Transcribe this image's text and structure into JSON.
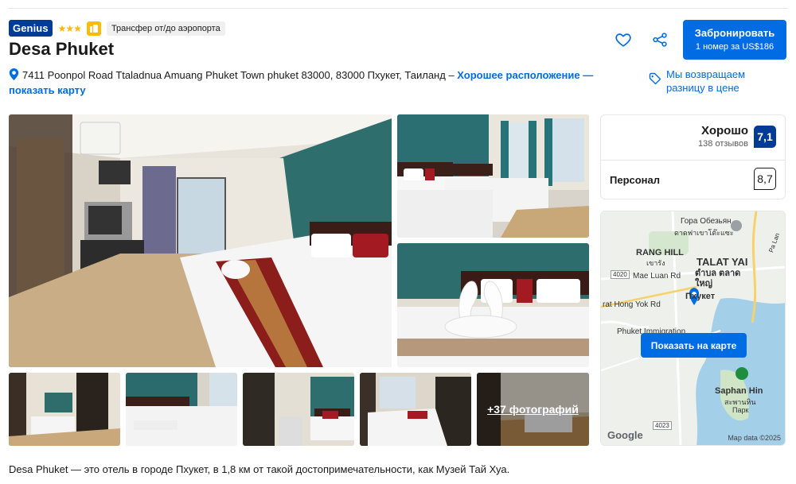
{
  "header": {
    "genius_label": "Genius",
    "stars": "★★★",
    "transfer_label": "Трансфер от/до аэропорта",
    "hotel_name": "Desa Phuket",
    "address": "7411 Poonpol Road Ttaladnua Amuang Phuket Town phuket 83000, 83000 Пхукет, Таиланд",
    "address_separator": " – ",
    "location_link": "Хорошее расположение — показать карту"
  },
  "actions": {
    "heart_icon": "heart-icon",
    "share_icon": "share-icon",
    "book_label": "Забронировать",
    "book_sublabel": "1 номер за US$186",
    "price_match": "Мы возвращаем разницу в цене"
  },
  "gallery": {
    "more_photos": "+37 фотографий"
  },
  "reviews": {
    "rating_word": "Хорошо",
    "review_count": "138 отзывов",
    "score": "7,1",
    "staff_label": "Персонал",
    "staff_score": "8,7"
  },
  "map": {
    "labels": {
      "monkey_hill": "Гора Обезьян",
      "monkey_hill_th": "ดาดฟาเขาโต๊ะแซะ",
      "rang_hill": "RANG HILL",
      "rang_hill_th": "เขารัง",
      "talat_yai": "TALAT YAI",
      "talat_yai_th": "ตำบล ตลาดใหญ่",
      "mae_luan": "Mae Luan Rd",
      "phuket": "Пхукет",
      "hong_yok": "rat Hong Yok Rd",
      "immigration": "Phuket Immigration",
      "saphan_hin": "Saphan Hin",
      "saphan_hin_th": "สะพานหิน",
      "park": "Парк",
      "pa_lan": "Pa Lan",
      "road_4020": "4020",
      "road_4023": "4023"
    },
    "button": "Показать на карте",
    "google": "Google",
    "map_data": "Map data ©2025"
  },
  "description": "Desa Phuket — это отель в городе Пхукет, в 1,8 км от такой достопримечательности, как Музей Тай Хуа.",
  "colors": {
    "brand_blue": "#003b95",
    "link_blue": "#006ce4",
    "star_yellow": "#febb02"
  }
}
